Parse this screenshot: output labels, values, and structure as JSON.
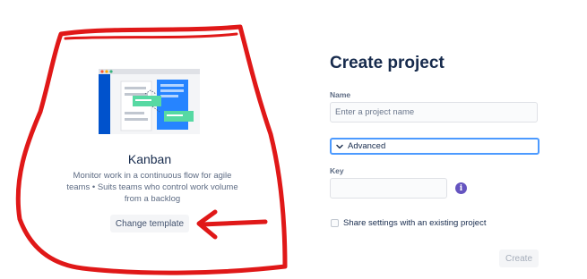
{
  "template": {
    "title": "Kanban",
    "description": "Monitor work in a continuous flow for agile teams • Suits teams who control work volume from a backlog",
    "change_label": "Change template"
  },
  "form": {
    "title": "Create project",
    "name_label": "Name",
    "name_placeholder": "Enter a project name",
    "advanced_label": "Advanced",
    "key_label": "Key",
    "key_value": "",
    "share_label": "Share settings with an existing project",
    "share_checked": false,
    "create_label": "Create"
  },
  "icons": {
    "advanced": "chevron-down-icon",
    "key_info": "info-icon"
  },
  "colors": {
    "primary_text": "#172b4d",
    "focus_border": "#4c9aff",
    "info_icon": "#6554c0",
    "annotation": "#e01818"
  }
}
